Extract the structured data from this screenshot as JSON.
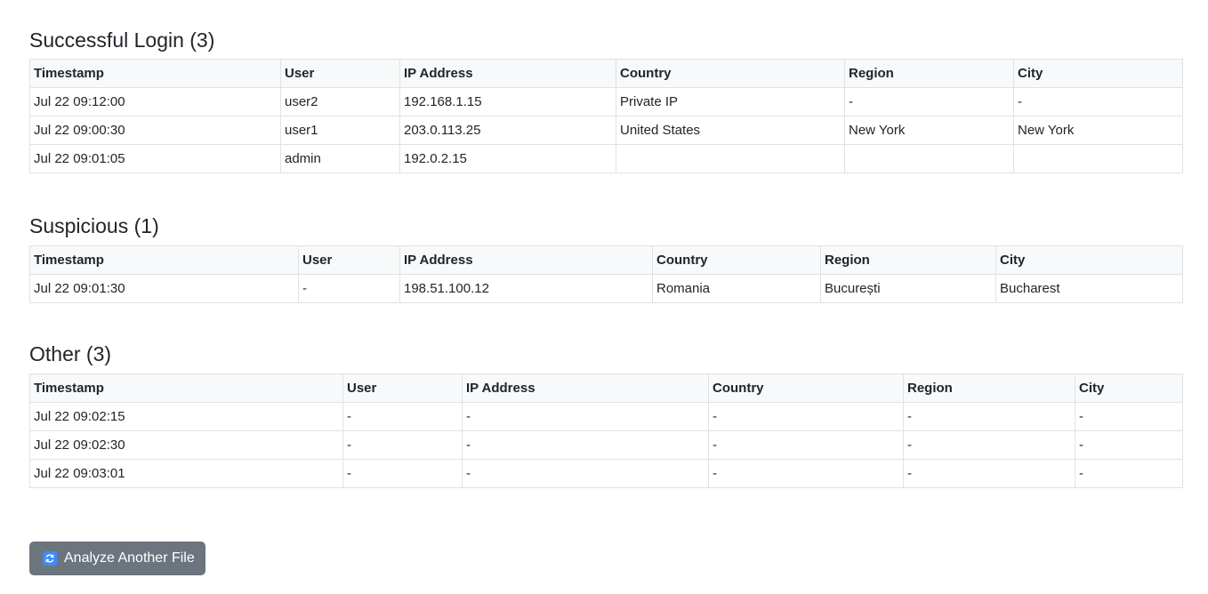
{
  "sections": [
    {
      "title": "Successful Login (3)",
      "columns": [
        "Timestamp",
        "User",
        "IP Address",
        "Country",
        "Region",
        "City"
      ],
      "rows": [
        [
          "Jul 22 09:12:00",
          "user2",
          "192.168.1.15",
          "Private IP",
          "-",
          "-"
        ],
        [
          "Jul 22 09:00:30",
          "user1",
          "203.0.113.25",
          "United States",
          "New York",
          "New York"
        ],
        [
          "Jul 22 09:01:05",
          "admin",
          "192.0.2.15",
          "",
          "",
          ""
        ]
      ]
    },
    {
      "title": "Suspicious (1)",
      "columns": [
        "Timestamp",
        "User",
        "IP Address",
        "Country",
        "Region",
        "City"
      ],
      "rows": [
        [
          "Jul 22 09:01:30",
          "-",
          "198.51.100.12",
          "Romania",
          "București",
          "Bucharest"
        ]
      ]
    },
    {
      "title": "Other (3)",
      "columns": [
        "Timestamp",
        "User",
        "IP Address",
        "Country",
        "Region",
        "City"
      ],
      "rows": [
        [
          "Jul 22 09:02:15",
          "-",
          "-",
          "-",
          "-",
          "-"
        ],
        [
          "Jul 22 09:02:30",
          "-",
          "-",
          "-",
          "-",
          "-"
        ],
        [
          "Jul 22 09:03:01",
          "-",
          "-",
          "-",
          "-",
          "-"
        ]
      ]
    }
  ],
  "analyze_button": {
    "label": "Analyze Another File",
    "icon": "refresh-icon"
  },
  "colors": {
    "button_bg": "#6c757d",
    "icon_bg": "#3d8bfd",
    "header_bg": "#f8f9fa",
    "border": "#dee2e6"
  }
}
